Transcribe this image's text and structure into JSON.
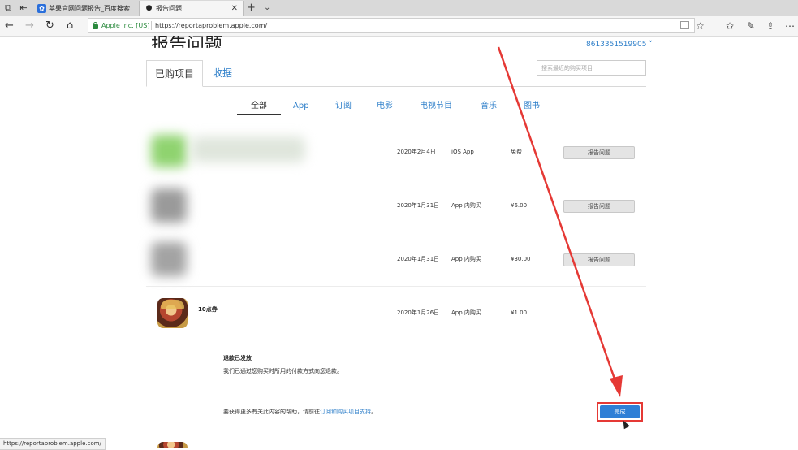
{
  "browser": {
    "tabs": [
      {
        "label": "苹果官网问题报告_百度搜索",
        "icon": "baidu-paw-icon"
      },
      {
        "label": "报告问题",
        "icon": "apple-icon"
      }
    ],
    "org_label": "Apple Inc. [US]",
    "url": "https://reportaproblem.apple.com/",
    "status_url": "https://reportaproblem.apple.com/"
  },
  "page": {
    "title": "报告问题",
    "account": "8613351519905 ˅",
    "tabs": [
      {
        "label": "已购项目"
      },
      {
        "label": "收据"
      }
    ],
    "search_placeholder": "搜索最近的购买项目",
    "filters": [
      "全部",
      "App",
      "订阅",
      "电影",
      "电视节目",
      "音乐",
      "图书"
    ],
    "items": [
      {
        "date": "2020年2月4日",
        "type": "iOS App",
        "price": "免费",
        "action": "报告问题"
      },
      {
        "date": "2020年1月31日",
        "type": "App 内购买",
        "price": "¥6.00",
        "action": "报告问题"
      },
      {
        "date": "2020年1月31日",
        "type": "App 内购买",
        "price": "¥30.00",
        "action": "报告问题"
      },
      {
        "name": "10点券",
        "date": "2020年1月26日",
        "type": "App 内购买",
        "price": "¥1.00"
      }
    ],
    "refund": {
      "title": "退款已发放",
      "desc": "我们已通过您购买时所用的付款方式向您退款。",
      "help_prefix": "要获得更多有关此内容的帮助，请前往",
      "help_link": "订阅和购买项目支持",
      "help_suffix": "。"
    },
    "done_button": "完成"
  },
  "colors": {
    "link": "#2c7ec9",
    "primary_button": "#2f7fd6",
    "annotation": "#e53935"
  }
}
